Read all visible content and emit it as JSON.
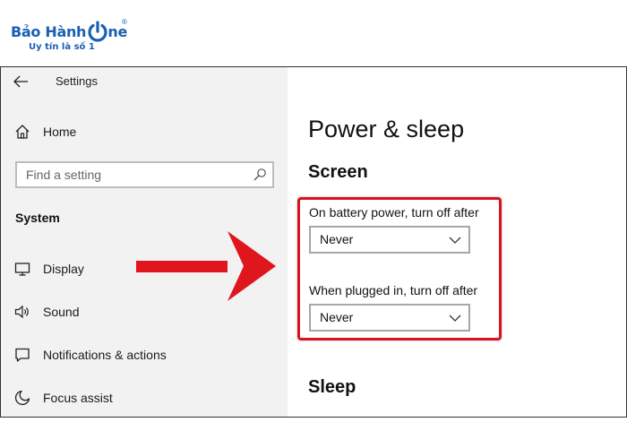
{
  "logo": {
    "brand_text": "Bảo Hành",
    "brand_suffix": "ne",
    "registered_mark": "®",
    "tagline": "Uy tín là số 1",
    "brand_color": "#1a5fb4"
  },
  "window": {
    "title": "Settings",
    "back_icon": "back-arrow-icon"
  },
  "sidebar": {
    "home": {
      "label": "Home",
      "icon": "home-icon"
    },
    "search": {
      "placeholder": "Find a setting",
      "icon": "search-icon"
    },
    "section_title": "System",
    "items": [
      {
        "label": "Display",
        "icon": "display-icon"
      },
      {
        "label": "Sound",
        "icon": "sound-icon"
      },
      {
        "label": "Notifications & actions",
        "icon": "notifications-icon"
      },
      {
        "label": "Focus assist",
        "icon": "focus-assist-icon"
      }
    ]
  },
  "main": {
    "page_title": "Power & sleep",
    "screen_heading": "Screen",
    "battery_label": "On battery power, turn off after",
    "battery_value": "Never",
    "plugged_label": "When plugged in, turn off after",
    "plugged_value": "Never",
    "sleep_heading": "Sleep"
  },
  "annotation": {
    "highlight_color": "#d7141c",
    "arrow_color": "#e0161e"
  }
}
